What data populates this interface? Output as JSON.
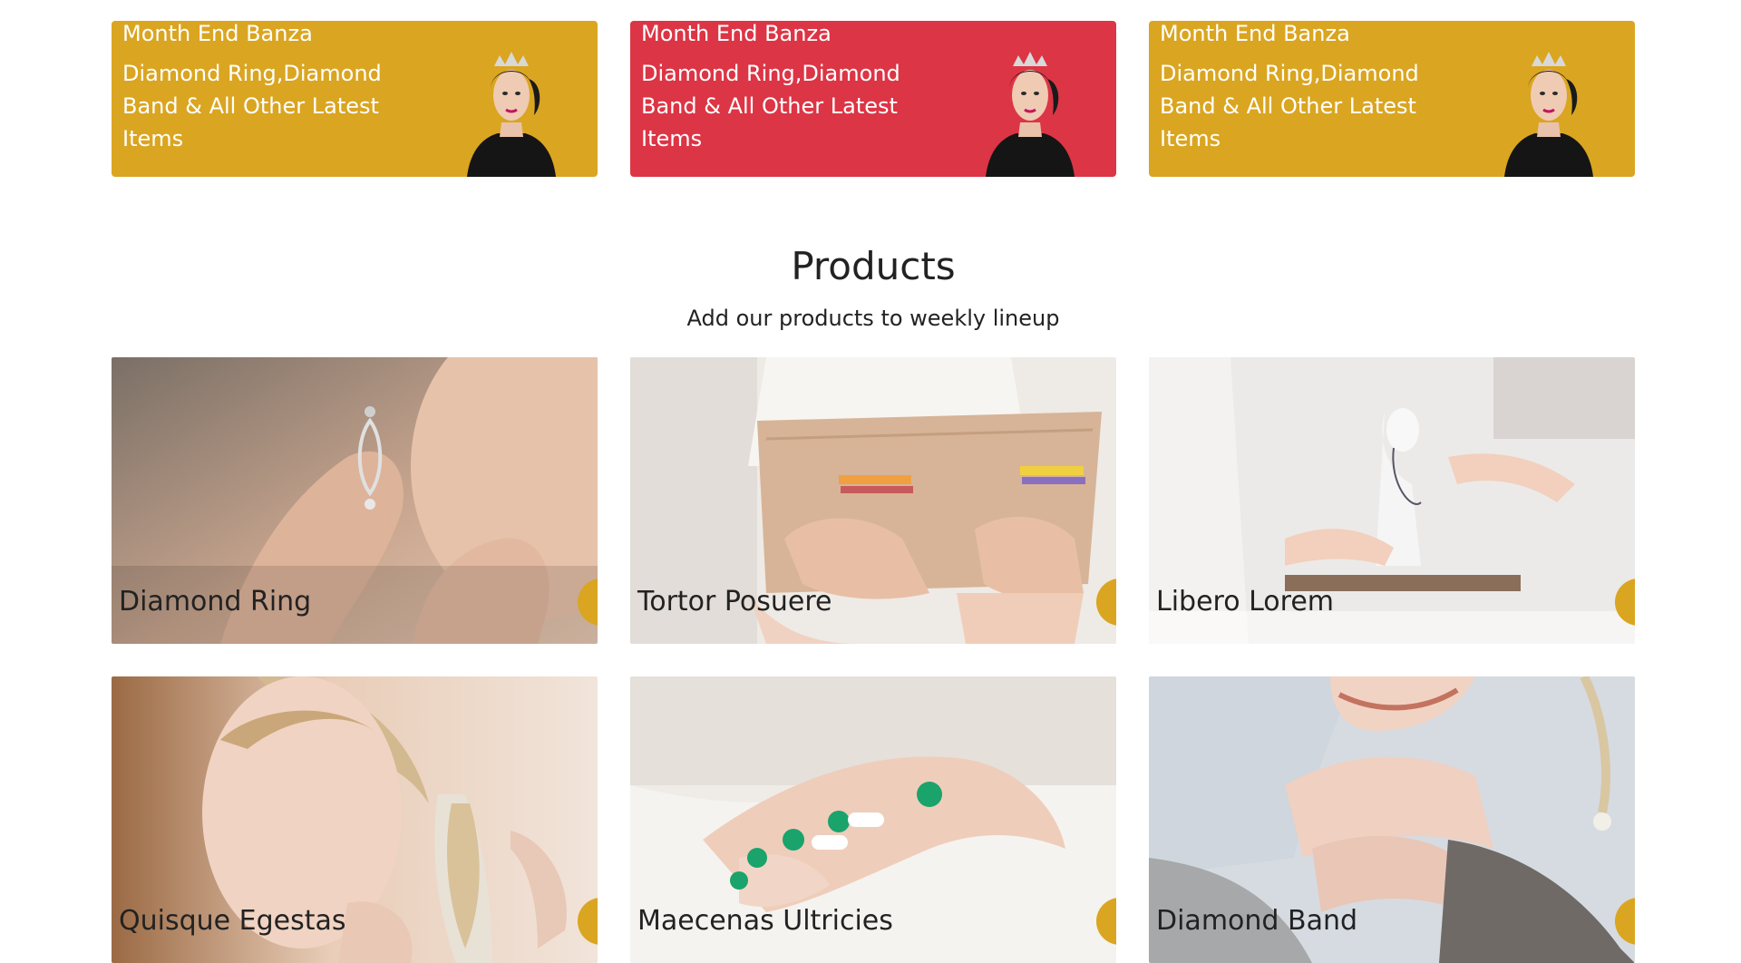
{
  "colors": {
    "gold": "#daa520",
    "red": "#dc3545",
    "text_dark": "#222222",
    "white": "#ffffff"
  },
  "banners": [
    {
      "heading": "Month End Banza",
      "text": "Diamond Ring,Diamond Band & All Other Latest Items",
      "bg": "gold"
    },
    {
      "heading": "Month End Banza",
      "text": "Diamond Ring,Diamond Band & All Other Latest Items",
      "bg": "red"
    },
    {
      "heading": "Month End Banza",
      "text": "Diamond Ring,Diamond Band & All Other Latest Items",
      "bg": "gold"
    }
  ],
  "products_section": {
    "title": "Products",
    "subtitle": "Add our products to weekly lineup"
  },
  "products": [
    {
      "name": "Diamond Ring"
    },
    {
      "name": "Tortor Posuere"
    },
    {
      "name": "Libero Lorem"
    },
    {
      "name": "Quisque Egestas"
    },
    {
      "name": "Maecenas Ultricies"
    },
    {
      "name": "Diamond Band"
    }
  ]
}
